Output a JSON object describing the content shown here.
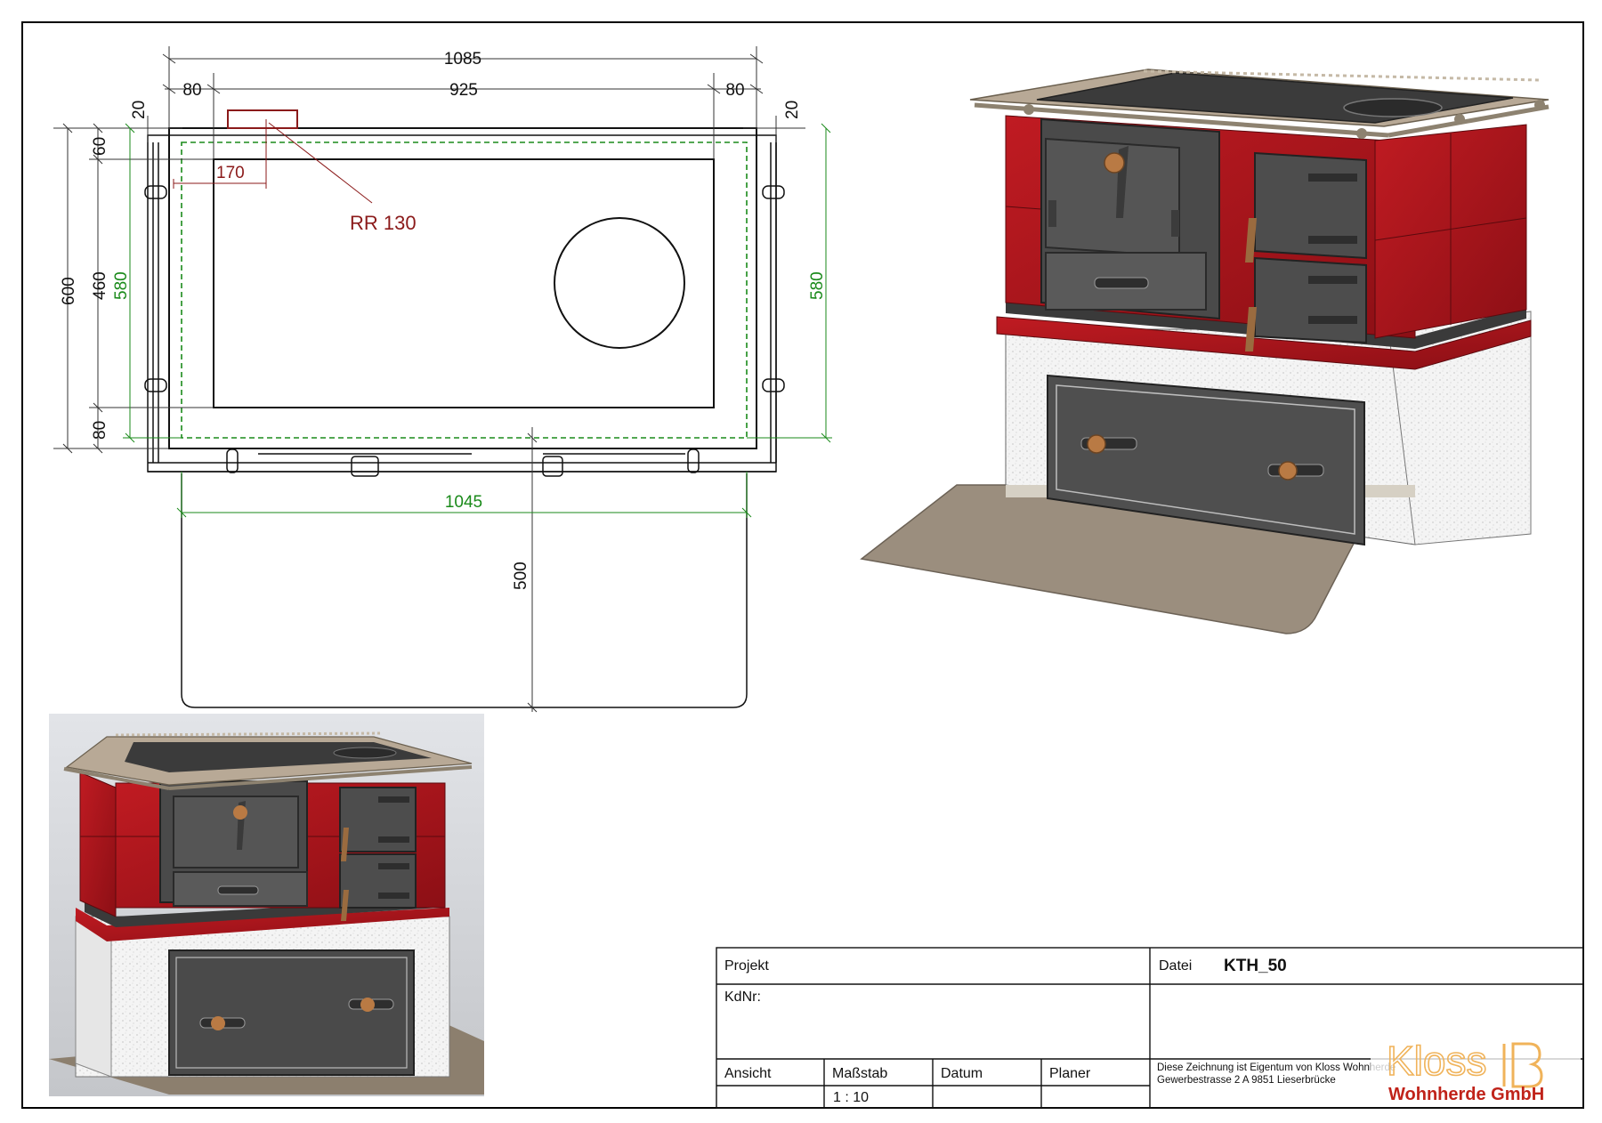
{
  "drawing": {
    "dims": {
      "overall_width": "1085",
      "left_margin": "80",
      "center_width": "925",
      "right_margin": "80",
      "left_offset": "20",
      "right_offset": "20",
      "top_band": "60",
      "flue_offset": "170",
      "flue_label": "RR 130",
      "height_total": "600",
      "height_inner": "460",
      "height_green_left": "580",
      "height_green_right": "580",
      "bottom_band": "80",
      "green_width": "1045",
      "clearance_depth": "500"
    }
  },
  "title_block": {
    "projekt_label": "Projekt",
    "kdnr_label": "KdNr:",
    "datei_label": "Datei",
    "datei_value": "KTH_50",
    "ansicht_label": "Ansicht",
    "massstab_label": "Maßstab",
    "massstab_value": "1 : 10",
    "datum_label": "Datum",
    "planer_label": "Planer",
    "owner_line1": "Diese Zeichnung ist Eigentum von Kloss Wohnherde",
    "owner_line2": "Gewerbestrasse 2 A 9851 Lieserbrücke",
    "logo_word": "Kloss",
    "logo_company": "Wohnherde GmbH"
  },
  "colors": {
    "tile_red": "#a3141b",
    "iron": "#4a4a4a",
    "dimension_green": "#1a8a1a",
    "flue_red": "#8b1a1a",
    "logo_orange": "#f0b35a",
    "logo_red": "#c0231a"
  }
}
